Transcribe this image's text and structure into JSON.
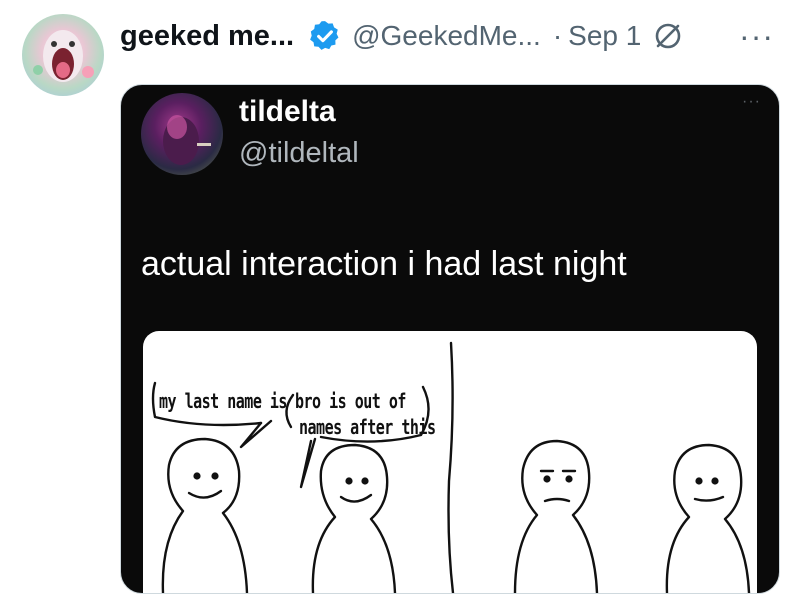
{
  "post": {
    "display_name": "geeked me...",
    "handle": "@GeekedMe...",
    "separator": "·",
    "date": "Sep 1",
    "more_label": "···"
  },
  "embedded_image": {
    "author_name": "tildelta",
    "author_handle": "@tildeltal",
    "more_label": "···",
    "text": "actual interaction i had last night",
    "comic": {
      "bubble_1": "my last name is",
      "bubble_2_line_1": "bro is out of",
      "bubble_2_line_2": "names after this"
    }
  },
  "icons": {
    "verified": "verified-badge-icon",
    "edit": "edited-post-icon"
  },
  "colors": {
    "verified_blue": "#1d9bf0",
    "secondary_text": "#536471",
    "primary_text": "#0f1419"
  }
}
